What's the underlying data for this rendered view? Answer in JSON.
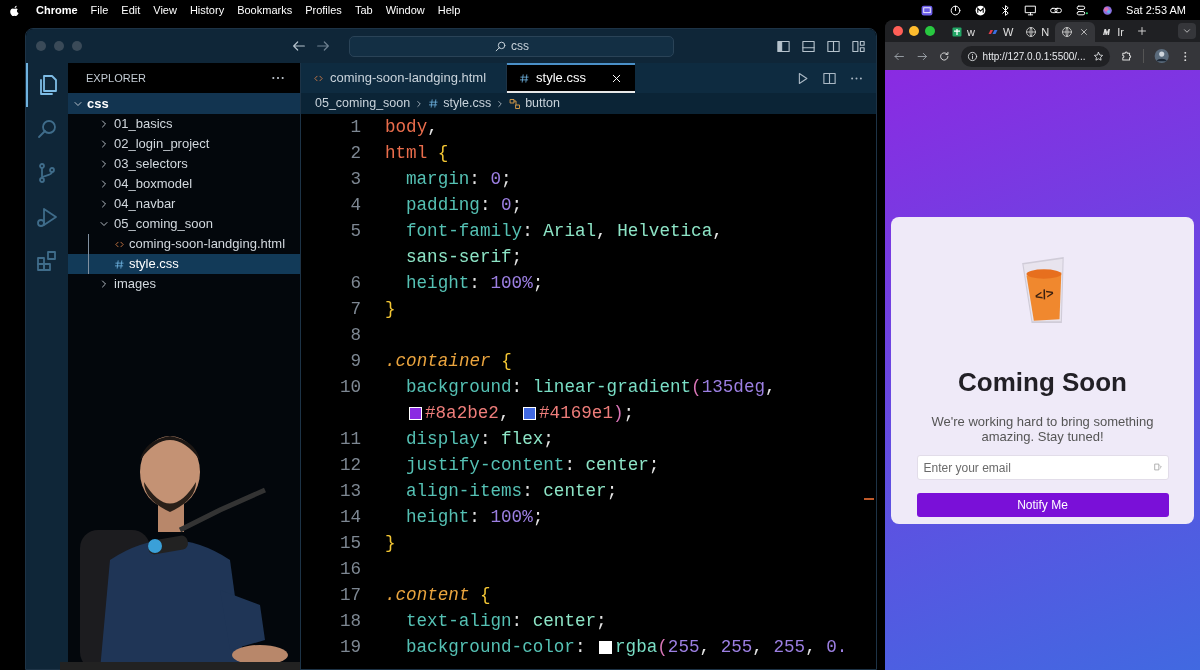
{
  "menubar": {
    "app": "Chrome",
    "items": [
      "File",
      "Edit",
      "View",
      "History",
      "Bookmarks",
      "Profiles",
      "Tab",
      "Window",
      "Help"
    ],
    "clock": "Sat 2:53 AM"
  },
  "editor_window": {
    "search": "css",
    "activity_bar": [
      {
        "kind": "files",
        "selected": true
      },
      {
        "kind": "search",
        "selected": false
      },
      {
        "kind": "source-control",
        "selected": false
      },
      {
        "kind": "debug",
        "selected": false
      },
      {
        "kind": "extensions",
        "selected": false
      }
    ],
    "explorer": {
      "title": "EXPLORER",
      "root": {
        "label": "css",
        "expanded": true,
        "children": [
          {
            "label": "01_basics",
            "kind": "folder",
            "expanded": false,
            "selected": false
          },
          {
            "label": "02_login_project",
            "kind": "folder",
            "expanded": false,
            "selected": false
          },
          {
            "label": "03_selectors",
            "kind": "folder",
            "expanded": false,
            "selected": false
          },
          {
            "label": "04_boxmodel",
            "kind": "folder",
            "expanded": false,
            "selected": false
          },
          {
            "label": "04_navbar",
            "kind": "folder",
            "expanded": false,
            "selected": false
          },
          {
            "label": "05_coming_soon",
            "kind": "folder",
            "expanded": true,
            "selected": false,
            "children": [
              {
                "label": "coming-soon-landging.html",
                "kind": "html",
                "selected": false
              },
              {
                "label": "style.css",
                "kind": "css",
                "selected": true
              }
            ]
          },
          {
            "label": "images",
            "kind": "folder",
            "expanded": false,
            "selected": false
          }
        ]
      }
    },
    "tabs": [
      {
        "label": "coming-soon-landging.html",
        "kind": "html",
        "selected": false
      },
      {
        "label": "style.css",
        "kind": "css",
        "selected": true
      }
    ],
    "breadcrumb": [
      {
        "label": "05_coming_soon",
        "kind": "folder"
      },
      {
        "label": "style.css",
        "kind": "css"
      },
      {
        "label": "button",
        "kind": "symbol"
      }
    ],
    "code_lines": [
      {
        "number": "1",
        "segments": [
          {
            "kind": "selector",
            "text": "body"
          },
          {
            "kind": "punct",
            "text": ","
          }
        ]
      },
      {
        "number": "2",
        "segments": [
          {
            "kind": "selector",
            "text": "html "
          },
          {
            "kind": "brace",
            "text": "{"
          }
        ]
      },
      {
        "number": "3",
        "indented": true,
        "segments": [
          {
            "kind": "property",
            "text": "margin"
          },
          {
            "kind": "punct",
            "text": ": "
          },
          {
            "kind": "number",
            "text": "0"
          },
          {
            "kind": "punct",
            "text": ";"
          }
        ]
      },
      {
        "number": "4",
        "indented": true,
        "segments": [
          {
            "kind": "property",
            "text": "padding"
          },
          {
            "kind": "punct",
            "text": ": "
          },
          {
            "kind": "number",
            "text": "0"
          },
          {
            "kind": "punct",
            "text": ";"
          }
        ]
      },
      {
        "number": "5",
        "indented": true,
        "segments": [
          {
            "kind": "property",
            "text": "font-family"
          },
          {
            "kind": "punct",
            "text": ": "
          },
          {
            "kind": "value",
            "text": "Arial"
          },
          {
            "kind": "punct",
            "text": ", "
          },
          {
            "kind": "value",
            "text": "Helvetica"
          },
          {
            "kind": "punct",
            "text": ","
          }
        ]
      },
      {
        "indented": true,
        "segments": [
          {
            "kind": "value",
            "text": "sans-serif"
          },
          {
            "kind": "punct",
            "text": ";"
          }
        ]
      },
      {
        "number": "6",
        "indented": true,
        "segments": [
          {
            "kind": "property",
            "text": "height"
          },
          {
            "kind": "punct",
            "text": ": "
          },
          {
            "kind": "number",
            "text": "100%"
          },
          {
            "kind": "punct",
            "text": ";"
          }
        ]
      },
      {
        "number": "7",
        "segments": [
          {
            "kind": "brace",
            "text": "}"
          }
        ]
      },
      {
        "number": "8"
      },
      {
        "number": "9",
        "segments": [
          {
            "kind": "class",
            "text": ".container "
          },
          {
            "kind": "brace",
            "text": "{"
          }
        ]
      },
      {
        "number": "10",
        "indented": true,
        "segments": [
          {
            "kind": "property",
            "text": "background"
          },
          {
            "kind": "punct",
            "text": ": "
          },
          {
            "kind": "function",
            "text": "linear-gradient"
          },
          {
            "kind": "paren",
            "text": "("
          },
          {
            "kind": "number",
            "text": "135deg"
          },
          {
            "kind": "punct",
            "text": ","
          }
        ]
      },
      {
        "indented": true,
        "segments": [
          {
            "kind": "swatch",
            "color": "#8a2be2"
          },
          {
            "kind": "hex",
            "text": "#8a2be2"
          },
          {
            "kind": "punct",
            "text": ", "
          },
          {
            "kind": "swatch",
            "color": "#4169e1"
          },
          {
            "kind": "hex",
            "text": "#4169e1"
          },
          {
            "kind": "paren",
            "text": ")"
          },
          {
            "kind": "punct",
            "text": ";"
          }
        ]
      },
      {
        "number": "11",
        "indented": true,
        "segments": [
          {
            "kind": "property",
            "text": "display"
          },
          {
            "kind": "punct",
            "text": ": "
          },
          {
            "kind": "value",
            "text": "flex"
          },
          {
            "kind": "punct",
            "text": ";"
          }
        ]
      },
      {
        "number": "12",
        "indented": true,
        "segments": [
          {
            "kind": "property",
            "text": "justify-content"
          },
          {
            "kind": "punct",
            "text": ": "
          },
          {
            "kind": "value",
            "text": "center"
          },
          {
            "kind": "punct",
            "text": ";"
          }
        ]
      },
      {
        "number": "13",
        "indented": true,
        "segments": [
          {
            "kind": "property",
            "text": "align-items"
          },
          {
            "kind": "punct",
            "text": ": "
          },
          {
            "kind": "value",
            "text": "center"
          },
          {
            "kind": "punct",
            "text": ";"
          }
        ]
      },
      {
        "number": "14",
        "indented": true,
        "segments": [
          {
            "kind": "property",
            "text": "height"
          },
          {
            "kind": "punct",
            "text": ": "
          },
          {
            "kind": "number",
            "text": "100%"
          },
          {
            "kind": "punct",
            "text": ";"
          }
        ]
      },
      {
        "number": "15",
        "segments": [
          {
            "kind": "brace",
            "text": "}"
          }
        ]
      },
      {
        "number": "16"
      },
      {
        "number": "17",
        "segments": [
          {
            "kind": "class",
            "text": ".content "
          },
          {
            "kind": "brace",
            "text": "{"
          }
        ]
      },
      {
        "number": "18",
        "indented": true,
        "segments": [
          {
            "kind": "property",
            "text": "text-align"
          },
          {
            "kind": "punct",
            "text": ": "
          },
          {
            "kind": "value",
            "text": "center"
          },
          {
            "kind": "punct",
            "text": ";"
          }
        ]
      },
      {
        "number": "19",
        "indented": true,
        "segments": [
          {
            "kind": "property",
            "text": "background-color"
          },
          {
            "kind": "punct",
            "text": ": "
          },
          {
            "kind": "swatch",
            "color": "#ffffff"
          },
          {
            "kind": "function",
            "text": "rgba"
          },
          {
            "kind": "paren",
            "text": "("
          },
          {
            "kind": "number",
            "text": "255"
          },
          {
            "kind": "punct",
            "text": ", "
          },
          {
            "kind": "number",
            "text": "255"
          },
          {
            "kind": "punct",
            "text": ", "
          },
          {
            "kind": "number",
            "text": "255"
          },
          {
            "kind": "punct",
            "text": ", "
          },
          {
            "kind": "number",
            "text": "0."
          }
        ]
      }
    ]
  },
  "browser_window": {
    "tabs": [
      {
        "label": "w",
        "kind": "sheet",
        "selected": false
      },
      {
        "label": "W",
        "kind": "brand",
        "selected": false
      },
      {
        "label": "N",
        "kind": "globe",
        "selected": false
      },
      {
        "kind": "globe",
        "selected": true
      },
      {
        "label": "Ir",
        "kind": "letter-m",
        "selected": false
      }
    ],
    "address": "http://127.0.0.1:5500/...",
    "page": {
      "logo_mark": "</>",
      "title": "Coming Soon",
      "text": "We're working hard to bring something amazing. Stay tuned!",
      "email": {
        "placeholder": "Enter your email"
      },
      "button": "Notify Me"
    }
  }
}
